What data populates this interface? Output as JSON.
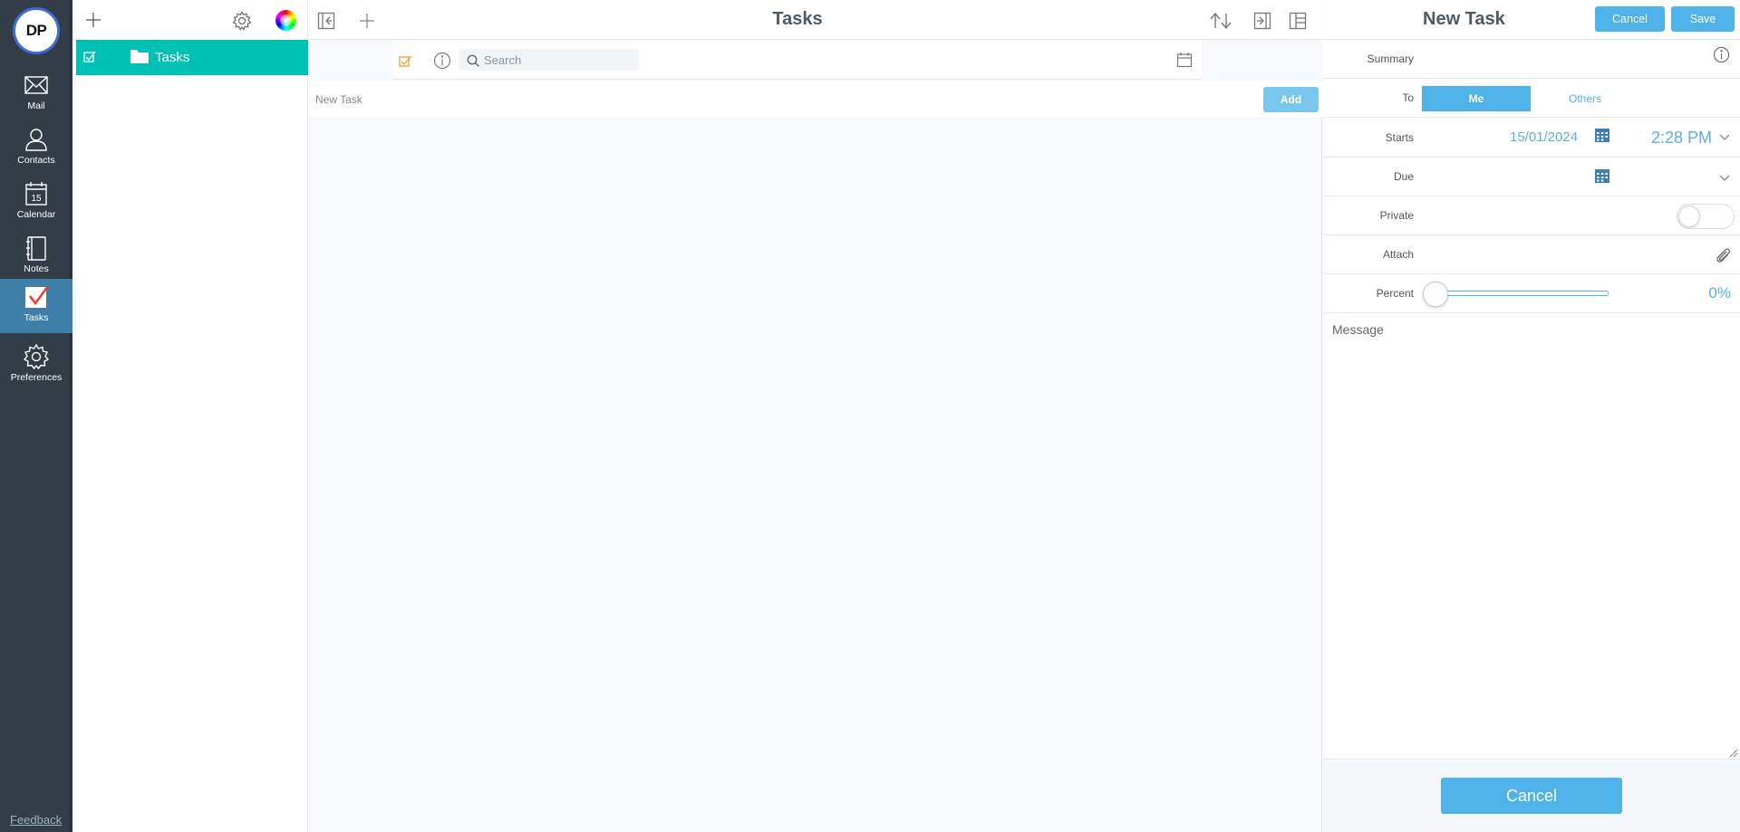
{
  "rail": {
    "avatar_initials": "DP",
    "items": [
      {
        "label": "Mail"
      },
      {
        "label": "Contacts"
      },
      {
        "label": "Calendar",
        "day": "15"
      },
      {
        "label": "Notes"
      },
      {
        "label": "Tasks"
      },
      {
        "label": "Preferences"
      }
    ],
    "active": "Tasks",
    "feedback": "Feedback"
  },
  "folders": {
    "items": [
      {
        "name": "Tasks"
      }
    ],
    "selected_color": "#00c2b4"
  },
  "center": {
    "title": "Tasks",
    "search_placeholder": "Search",
    "new_task_placeholder": "New Task",
    "add_label": "Add"
  },
  "form": {
    "title": "New Task",
    "cancel_label": "Cancel",
    "save_label": "Save",
    "summary_label": "Summary",
    "to_label": "To",
    "to_options": [
      "Me",
      "Others"
    ],
    "to_selected": "Me",
    "starts_label": "Starts",
    "starts_date": "15/01/2024",
    "starts_time": "2:28 PM",
    "due_label": "Due",
    "private_label": "Private",
    "private_on": false,
    "attach_label": "Attach",
    "percent_label": "Percent",
    "percent_value": "0%",
    "percent_fraction": 0,
    "message_placeholder": "Message",
    "bottom_cancel_label": "Cancel"
  },
  "colors": {
    "accent_blue": "#4fb2e8",
    "rail_bg": "#323d47",
    "rail_active": "#3d7fa9",
    "tasks_check": "#f0a030"
  }
}
